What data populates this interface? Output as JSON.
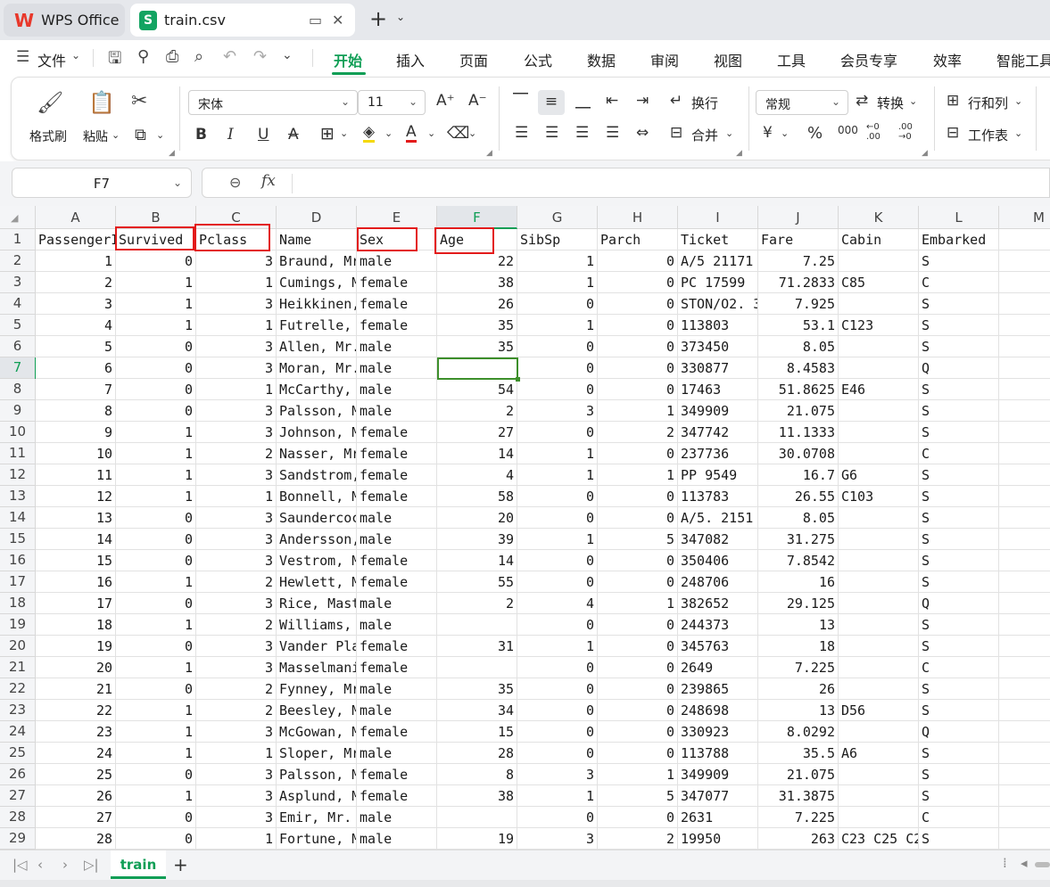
{
  "tabs": {
    "app_label": "WPS Office",
    "file_label": "train.csv",
    "file_badge": "S",
    "new_tab": "+"
  },
  "menu": {
    "file_label": "文件",
    "items": [
      "开始",
      "插入",
      "页面",
      "公式",
      "数据",
      "审阅",
      "视图",
      "工具",
      "会员专享",
      "效率",
      "智能工具"
    ],
    "active_index": 0
  },
  "ribbon": {
    "format_painter": "格式刷",
    "paste": "粘贴",
    "font_name": "宋体",
    "font_size": "11",
    "wrap": "换行",
    "merge": "合并",
    "number_format": "常规",
    "convert": "转换",
    "rows_cols": "行和列",
    "worksheet": "工作表",
    "percent": "%",
    "thousands": "000",
    "dec_more": "←0 .00",
    "dec_less": ".00 →0"
  },
  "formula_bar": {
    "cell_ref": "F7",
    "fx": "fx",
    "content": ""
  },
  "sheet": {
    "columns": [
      "A",
      "B",
      "C",
      "D",
      "E",
      "F",
      "G",
      "H",
      "I",
      "J",
      "K",
      "L",
      "M"
    ],
    "row_numbers": [
      "1",
      "2",
      "3",
      "4",
      "5",
      "6",
      "7",
      "8",
      "9",
      "10",
      "11",
      "12",
      "13",
      "14",
      "15",
      "16",
      "17",
      "18",
      "19",
      "20",
      "21",
      "22",
      "23",
      "24",
      "25",
      "26",
      "27",
      "28",
      "29"
    ],
    "selected_column": "F",
    "selected_row": "7",
    "headers": [
      "PassengerId",
      "Survived",
      "Pclass",
      "Name",
      "Sex",
      "Age",
      "SibSp",
      "Parch",
      "Ticket",
      "Fare",
      "Cabin",
      "Embarked"
    ],
    "rows": [
      [
        "1",
        "0",
        "3",
        "Braund, Mr",
        "male",
        "22",
        "1",
        "0",
        "A/5 21171",
        "7.25",
        "",
        "S"
      ],
      [
        "2",
        "1",
        "1",
        "Cumings, M",
        "female",
        "38",
        "1",
        "0",
        "PC 17599",
        "71.2833",
        "C85",
        "C"
      ],
      [
        "3",
        "1",
        "3",
        "Heikkinen,",
        "female",
        "26",
        "0",
        "0",
        "STON/O2. 3",
        "7.925",
        "",
        "S"
      ],
      [
        "4",
        "1",
        "1",
        "Futrelle,",
        "female",
        "35",
        "1",
        "0",
        "113803",
        "53.1",
        "C123",
        "S"
      ],
      [
        "5",
        "0",
        "3",
        "Allen, Mr.",
        "male",
        "35",
        "0",
        "0",
        "373450",
        "8.05",
        "",
        "S"
      ],
      [
        "6",
        "0",
        "3",
        "Moran, Mr.",
        "male",
        "",
        "0",
        "0",
        "330877",
        "8.4583",
        "",
        "Q"
      ],
      [
        "7",
        "0",
        "1",
        "McCarthy,",
        "male",
        "54",
        "0",
        "0",
        "17463",
        "51.8625",
        "E46",
        "S"
      ],
      [
        "8",
        "0",
        "3",
        "Palsson, M",
        "male",
        "2",
        "3",
        "1",
        "349909",
        "21.075",
        "",
        "S"
      ],
      [
        "9",
        "1",
        "3",
        "Johnson, M",
        "female",
        "27",
        "0",
        "2",
        "347742",
        "11.1333",
        "",
        "S"
      ],
      [
        "10",
        "1",
        "2",
        "Nasser, Mr",
        "female",
        "14",
        "1",
        "0",
        "237736",
        "30.0708",
        "",
        "C"
      ],
      [
        "11",
        "1",
        "3",
        "Sandstrom,",
        "female",
        "4",
        "1",
        "1",
        "PP 9549",
        "16.7",
        "G6",
        "S"
      ],
      [
        "12",
        "1",
        "1",
        "Bonnell, M",
        "female",
        "58",
        "0",
        "0",
        "113783",
        "26.55",
        "C103",
        "S"
      ],
      [
        "13",
        "0",
        "3",
        "Saundercoc",
        "male",
        "20",
        "0",
        "0",
        "A/5. 2151",
        "8.05",
        "",
        "S"
      ],
      [
        "14",
        "0",
        "3",
        "Andersson,",
        "male",
        "39",
        "1",
        "5",
        "347082",
        "31.275",
        "",
        "S"
      ],
      [
        "15",
        "0",
        "3",
        "Vestrom, M",
        "female",
        "14",
        "0",
        "0",
        "350406",
        "7.8542",
        "",
        "S"
      ],
      [
        "16",
        "1",
        "2",
        "Hewlett, M",
        "female",
        "55",
        "0",
        "0",
        "248706",
        "16",
        "",
        "S"
      ],
      [
        "17",
        "0",
        "3",
        "Rice, Mast",
        "male",
        "2",
        "4",
        "1",
        "382652",
        "29.125",
        "",
        "Q"
      ],
      [
        "18",
        "1",
        "2",
        "Williams, ",
        "male",
        "",
        "0",
        "0",
        "244373",
        "13",
        "",
        "S"
      ],
      [
        "19",
        "0",
        "3",
        "Vander Pla",
        "female",
        "31",
        "1",
        "0",
        "345763",
        "18",
        "",
        "S"
      ],
      [
        "20",
        "1",
        "3",
        "Masselmani",
        "female",
        "",
        "0",
        "0",
        "2649",
        "7.225",
        "",
        "C"
      ],
      [
        "21",
        "0",
        "2",
        "Fynney, Mr",
        "male",
        "35",
        "0",
        "0",
        "239865",
        "26",
        "",
        "S"
      ],
      [
        "22",
        "1",
        "2",
        "Beesley, M",
        "male",
        "34",
        "0",
        "0",
        "248698",
        "13",
        "D56",
        "S"
      ],
      [
        "23",
        "1",
        "3",
        "McGowan, M",
        "female",
        "15",
        "0",
        "0",
        "330923",
        "8.0292",
        "",
        "Q"
      ],
      [
        "24",
        "1",
        "1",
        "Sloper, Mr",
        "male",
        "28",
        "0",
        "0",
        "113788",
        "35.5",
        "A6",
        "S"
      ],
      [
        "25",
        "0",
        "3",
        "Palsson, M",
        "female",
        "8",
        "3",
        "1",
        "349909",
        "21.075",
        "",
        "S"
      ],
      [
        "26",
        "1",
        "3",
        "Asplund, M",
        "female",
        "38",
        "1",
        "5",
        "347077",
        "31.3875",
        "",
        "S"
      ],
      [
        "27",
        "0",
        "3",
        "Emir, Mr. ",
        "male",
        "",
        "0",
        "0",
        "2631",
        "7.225",
        "",
        "C"
      ],
      [
        "28",
        "0",
        "1",
        "Fortune, M",
        "male",
        "19",
        "3",
        "2",
        "19950",
        "263",
        "C23 C25 C2",
        "S"
      ]
    ],
    "numeric_columns": [
      0,
      1,
      2,
      5,
      6,
      7,
      9
    ],
    "highlighted_headers": [
      "Survived",
      "Pclass",
      "Sex",
      "Age"
    ]
  },
  "sheet_tabs": {
    "active": "train",
    "add": "+"
  },
  "colors": {
    "accent": "#0f9e55",
    "highlight_box": "#e31b1b",
    "active_cell": "#3d8f2b"
  }
}
